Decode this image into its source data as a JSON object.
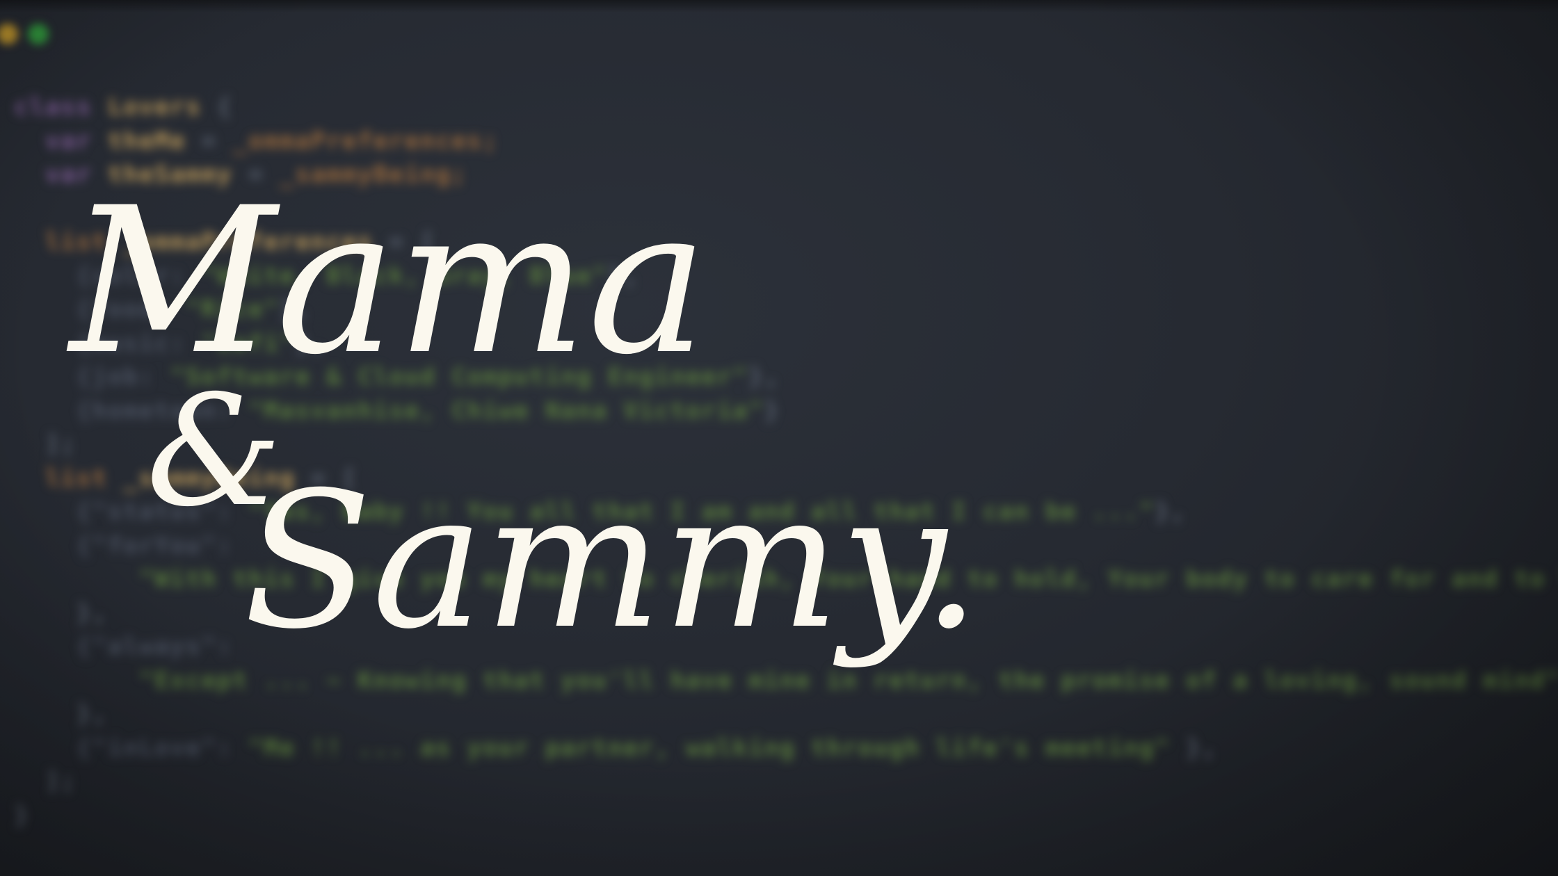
{
  "window": {
    "title_lights": [
      "minimize",
      "zoom"
    ]
  },
  "code_lines": [
    {
      "parts": [
        {
          "t": "class ",
          "c": "c-kw"
        },
        {
          "t": "Lovers ",
          "c": "c-name"
        },
        {
          "t": "{",
          "c": "c-punc"
        }
      ]
    },
    {
      "parts": [
        {
          "t": "  var ",
          "c": "c-kw"
        },
        {
          "t": "theMe ",
          "c": "c-name"
        },
        {
          "t": "= ",
          "c": "c-punc"
        },
        {
          "t": "_ommaPreferences;",
          "c": "c-orange"
        }
      ]
    },
    {
      "parts": [
        {
          "t": "  var ",
          "c": "c-kw"
        },
        {
          "t": "theSammy ",
          "c": "c-name"
        },
        {
          "t": "= ",
          "c": "c-punc"
        },
        {
          "t": "_sammyBeing;",
          "c": "c-orange"
        }
      ]
    },
    {
      "parts": []
    },
    {
      "parts": [
        {
          "t": "  list ",
          "c": "c-orange"
        },
        {
          "t": "_ommaPreferences ",
          "c": "c-name"
        },
        {
          "t": "= [",
          "c": "c-punc"
        }
      ]
    },
    {
      "parts": [
        {
          "t": "    {color: ",
          "c": "c-dim"
        },
        {
          "t": "\"White, Black, Gray, Blue\"",
          "c": "c-str"
        },
        {
          "t": "},",
          "c": "c-punc"
        }
      ]
    },
    {
      "parts": [
        {
          "t": "    {food: ",
          "c": "c-dim"
        },
        {
          "t": "\"Rice\"",
          "c": "c-str"
        },
        {
          "t": "},",
          "c": "c-punc"
        }
      ]
    },
    {
      "parts": [
        {
          "t": "    {music: ",
          "c": "c-dim"
        },
        {
          "t": "\"Lofi\"",
          "c": "c-str"
        },
        {
          "t": "},",
          "c": "c-punc"
        }
      ]
    },
    {
      "parts": [
        {
          "t": "    {job: ",
          "c": "c-dim"
        },
        {
          "t": "\"Software & Cloud Computing Engineer\"",
          "c": "c-str"
        },
        {
          "t": "},",
          "c": "c-punc"
        }
      ]
    },
    {
      "parts": [
        {
          "t": "    {hometown: ",
          "c": "c-dim"
        },
        {
          "t": "\"Masvanhise, Chiwe Nana Victoria\"",
          "c": "c-str"
        },
        {
          "t": "}",
          "c": "c-punc"
        }
      ]
    },
    {
      "parts": [
        {
          "t": "  ];",
          "c": "c-punc"
        }
      ]
    },
    {
      "parts": [
        {
          "t": "  list ",
          "c": "c-orange"
        },
        {
          "t": "_sammyBeing ",
          "c": "c-name"
        },
        {
          "t": "= [",
          "c": "c-punc"
        }
      ]
    },
    {
      "parts": [
        {
          "t": "    {\"status\": ",
          "c": "c-dim"
        },
        {
          "t": "\"Yes, Baby !! You all that I am and all that I can be ...\"",
          "c": "c-str"
        },
        {
          "t": "},",
          "c": "c-punc"
        }
      ]
    },
    {
      "parts": [
        {
          "t": "    {\"forYou\": ",
          "c": "c-dim"
        }
      ]
    },
    {
      "parts": [
        {
          "t": "        \"With this I give you my heart to cherish, Your hand to hold, Your body to care for and to love\"",
          "c": "c-str"
        }
      ]
    },
    {
      "parts": [
        {
          "t": "    },",
          "c": "c-punc"
        }
      ]
    },
    {
      "parts": [
        {
          "t": "    {\"always\": ",
          "c": "c-dim"
        }
      ]
    },
    {
      "parts": [
        {
          "t": "        \"Except ... ~ Knowing that you'll have mine in return, the promise of a loving, sound mind\"",
          "c": "c-str"
        }
      ]
    },
    {
      "parts": [
        {
          "t": "    },",
          "c": "c-punc"
        }
      ]
    },
    {
      "parts": [
        {
          "t": "    {\"inLove\": ",
          "c": "c-dim"
        },
        {
          "t": "\"Me !! ... as your partner, walking through life's meeting\"",
          "c": "c-str"
        },
        {
          "t": " },",
          "c": "c-punc"
        }
      ]
    },
    {
      "parts": [
        {
          "t": "  ];",
          "c": "c-punc"
        }
      ]
    },
    {
      "parts": [
        {
          "t": "}",
          "c": "c-punc"
        }
      ]
    }
  ],
  "overlay": {
    "line1": "Mama",
    "line2": "&",
    "line3": "Sammy."
  },
  "colors": {
    "background": "#262a32",
    "script_text": "#fbf8ee"
  }
}
